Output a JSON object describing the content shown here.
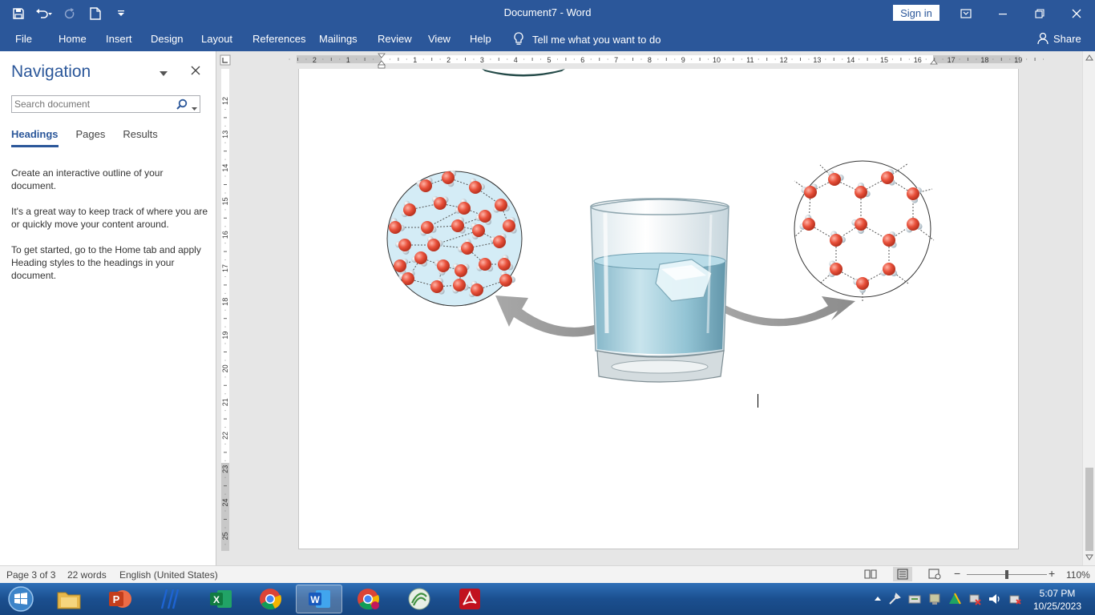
{
  "window": {
    "title": "Document7 - Word",
    "sign_in_label": "Sign in"
  },
  "ribbon": {
    "tabs": [
      "File",
      "Home",
      "Insert",
      "Design",
      "Layout",
      "References",
      "Mailings",
      "Review",
      "View",
      "Help"
    ],
    "tell_me": "Tell me what you want to do",
    "share": "Share"
  },
  "navigation": {
    "title": "Navigation",
    "search_placeholder": "Search document",
    "tabs": [
      "Headings",
      "Pages",
      "Results"
    ],
    "active_tab": "Headings",
    "paragraphs": [
      "Create an interactive outline of your document.",
      "It's a great way to keep track of where you are or quickly move your content around.",
      "To get started, go to the Home tab and apply Heading styles to the headings in your document."
    ]
  },
  "ruler": {
    "horizontal_labels": [
      "2",
      "1",
      "1",
      "2",
      "3",
      "4",
      "5",
      "6",
      "7",
      "8",
      "9",
      "10",
      "11",
      "12",
      "13",
      "14",
      "15",
      "16",
      "17",
      "18",
      "19"
    ],
    "vertical_labels": [
      "12",
      "13",
      "14",
      "15",
      "16",
      "17",
      "18",
      "19",
      "20",
      "21",
      "22",
      "23",
      "24",
      "25"
    ]
  },
  "status": {
    "page": "Page 3 of 3",
    "words": "22 words",
    "language": "English (United States)",
    "zoom": "110%",
    "zoom_minus": "−",
    "zoom_plus": "+"
  },
  "taskbar": {
    "apps": [
      "start-orb-icon",
      "file-explorer-icon",
      "powerpoint-icon",
      "notepad-icon",
      "excel-icon",
      "chrome-icon",
      "word-icon",
      "chrome-profile-icon",
      "app-icon",
      "acrobat-icon"
    ],
    "active_app": "word-icon",
    "time": "5:07 PM",
    "date": "10/25/2023"
  },
  "colors": {
    "word_blue": "#2b579a",
    "water_molecule_oxygen": "#e8503a",
    "water_molecule_hydrogen": "#c9d6de"
  }
}
